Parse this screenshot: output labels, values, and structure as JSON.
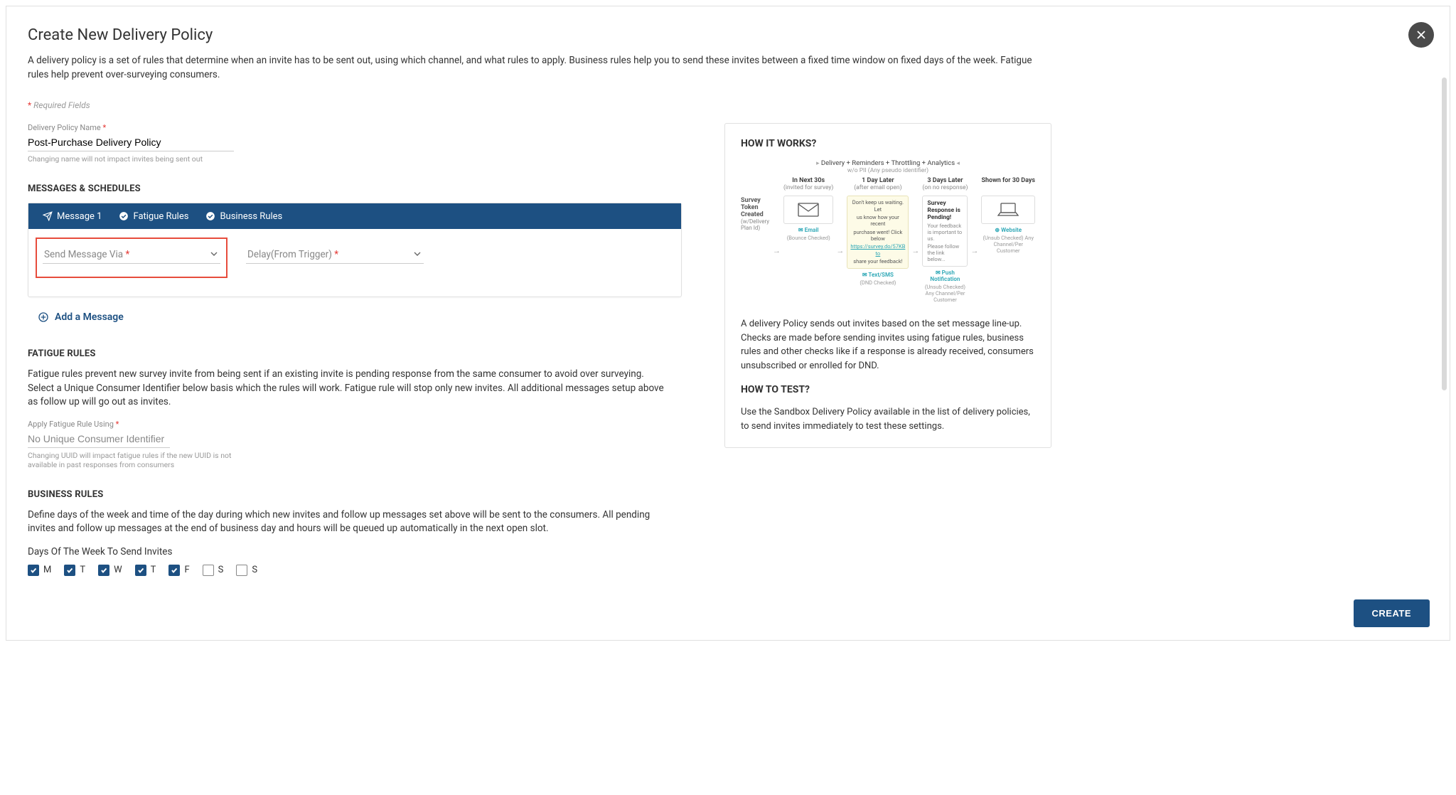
{
  "header": {
    "title": "Create New Delivery Policy",
    "intro": "A delivery policy is a set of rules that determine when an invite has to be sent out, using which channel, and what rules to apply. Business rules help you to send these invites between a fixed time window on fixed days of the week. Fatigue rules help prevent over-surveying consumers.",
    "required_fields_label": "Required Fields"
  },
  "policy_name": {
    "label": "Delivery Policy Name",
    "value": "Post-Purchase Delivery Policy",
    "hint": "Changing name will not impact invites being sent out"
  },
  "sections": {
    "messages_heading": "MESSAGES & SCHEDULES",
    "fatigue_heading": "FATIGUE RULES",
    "business_heading": "BUSINESS RULES"
  },
  "tabs": {
    "message1": "Message 1",
    "fatigue": "Fatigue Rules",
    "business": "Business Rules"
  },
  "message_form": {
    "send_via_label": "Send Message Via",
    "delay_label": "Delay(From Trigger)"
  },
  "add_message_label": "Add a Message",
  "fatigue": {
    "description": "Fatigue rules prevent new survey invite from being sent if an existing invite is pending response from the same consumer to avoid over surveying. Select a Unique Consumer Identifier below basis which the rules will work. Fatigue rule will stop only new invites. All additional messages setup above as follow up will go out as invites.",
    "apply_label": "Apply Fatigue Rule Using",
    "apply_value": "No Unique Consumer Identifier",
    "apply_hint": "Changing UUID will impact fatigue rules if the new UUID is not available in past responses from consumers"
  },
  "business": {
    "description": "Define days of the week and time of the day during which new invites and follow up messages set above will be sent to the consumers. All pending invites and follow up messages at the end of business day and hours will be queued up automatically in the next open slot.",
    "days_label": "Days Of The Week To Send Invites",
    "days": [
      {
        "label": "M",
        "checked": true
      },
      {
        "label": "T",
        "checked": true
      },
      {
        "label": "W",
        "checked": true
      },
      {
        "label": "T",
        "checked": true
      },
      {
        "label": "F",
        "checked": true
      },
      {
        "label": "S",
        "checked": false
      },
      {
        "label": "S",
        "checked": false
      }
    ]
  },
  "info": {
    "how_works_title": "HOW IT WORKS?",
    "how_works_body": "A delivery Policy sends out invites based on the set message line-up. Checks are made before sending invites using fatigue rules, business rules and other checks like if a response is already received, consumers unsubscribed or enrolled for DND.",
    "how_test_title": "HOW TO TEST?",
    "how_test_body": "Use the Sandbox Delivery Policy available in the list of delivery policies, to send invites immediately to test these settings."
  },
  "diagram": {
    "header_main": "Delivery + Reminders + Throttling + Analytics",
    "header_sub": "w/o PII (Any pseudo identifier)",
    "token": {
      "line1": "Survey Token Created",
      "line2": "(w/Delivery Plan Id)"
    },
    "steps": [
      {
        "top1": "In Next 30s",
        "top2": "(invited for survey)",
        "service": "Email",
        "foot": "(Bounce Checked)"
      },
      {
        "top1": "1 Day Later",
        "top2": "(after email open)",
        "service": "Text/SMS",
        "foot": "(DND Checked)",
        "note_lines": [
          "Don't keep us waiting. Let",
          "us know how your recent",
          "purchase went! Click below",
          "https://survey.do/57KB to",
          "share your feedback!"
        ]
      },
      {
        "top1": "3 Days Later",
        "top2": "(on no response)",
        "service": "Push Notification",
        "foot": "(Unsub Checked) Any Channel/Per Customer",
        "pending_title": "Survey Response is Pending!",
        "pending_sub1": "Your feedback is important to us.",
        "pending_sub2": "Please follow the link below..."
      },
      {
        "top1": "Shown for 30 Days",
        "top2": "",
        "service": "Website",
        "foot": "(Unsub Checked) Any Channel/Per Customer"
      }
    ]
  },
  "footer": {
    "create_label": "CREATE"
  }
}
